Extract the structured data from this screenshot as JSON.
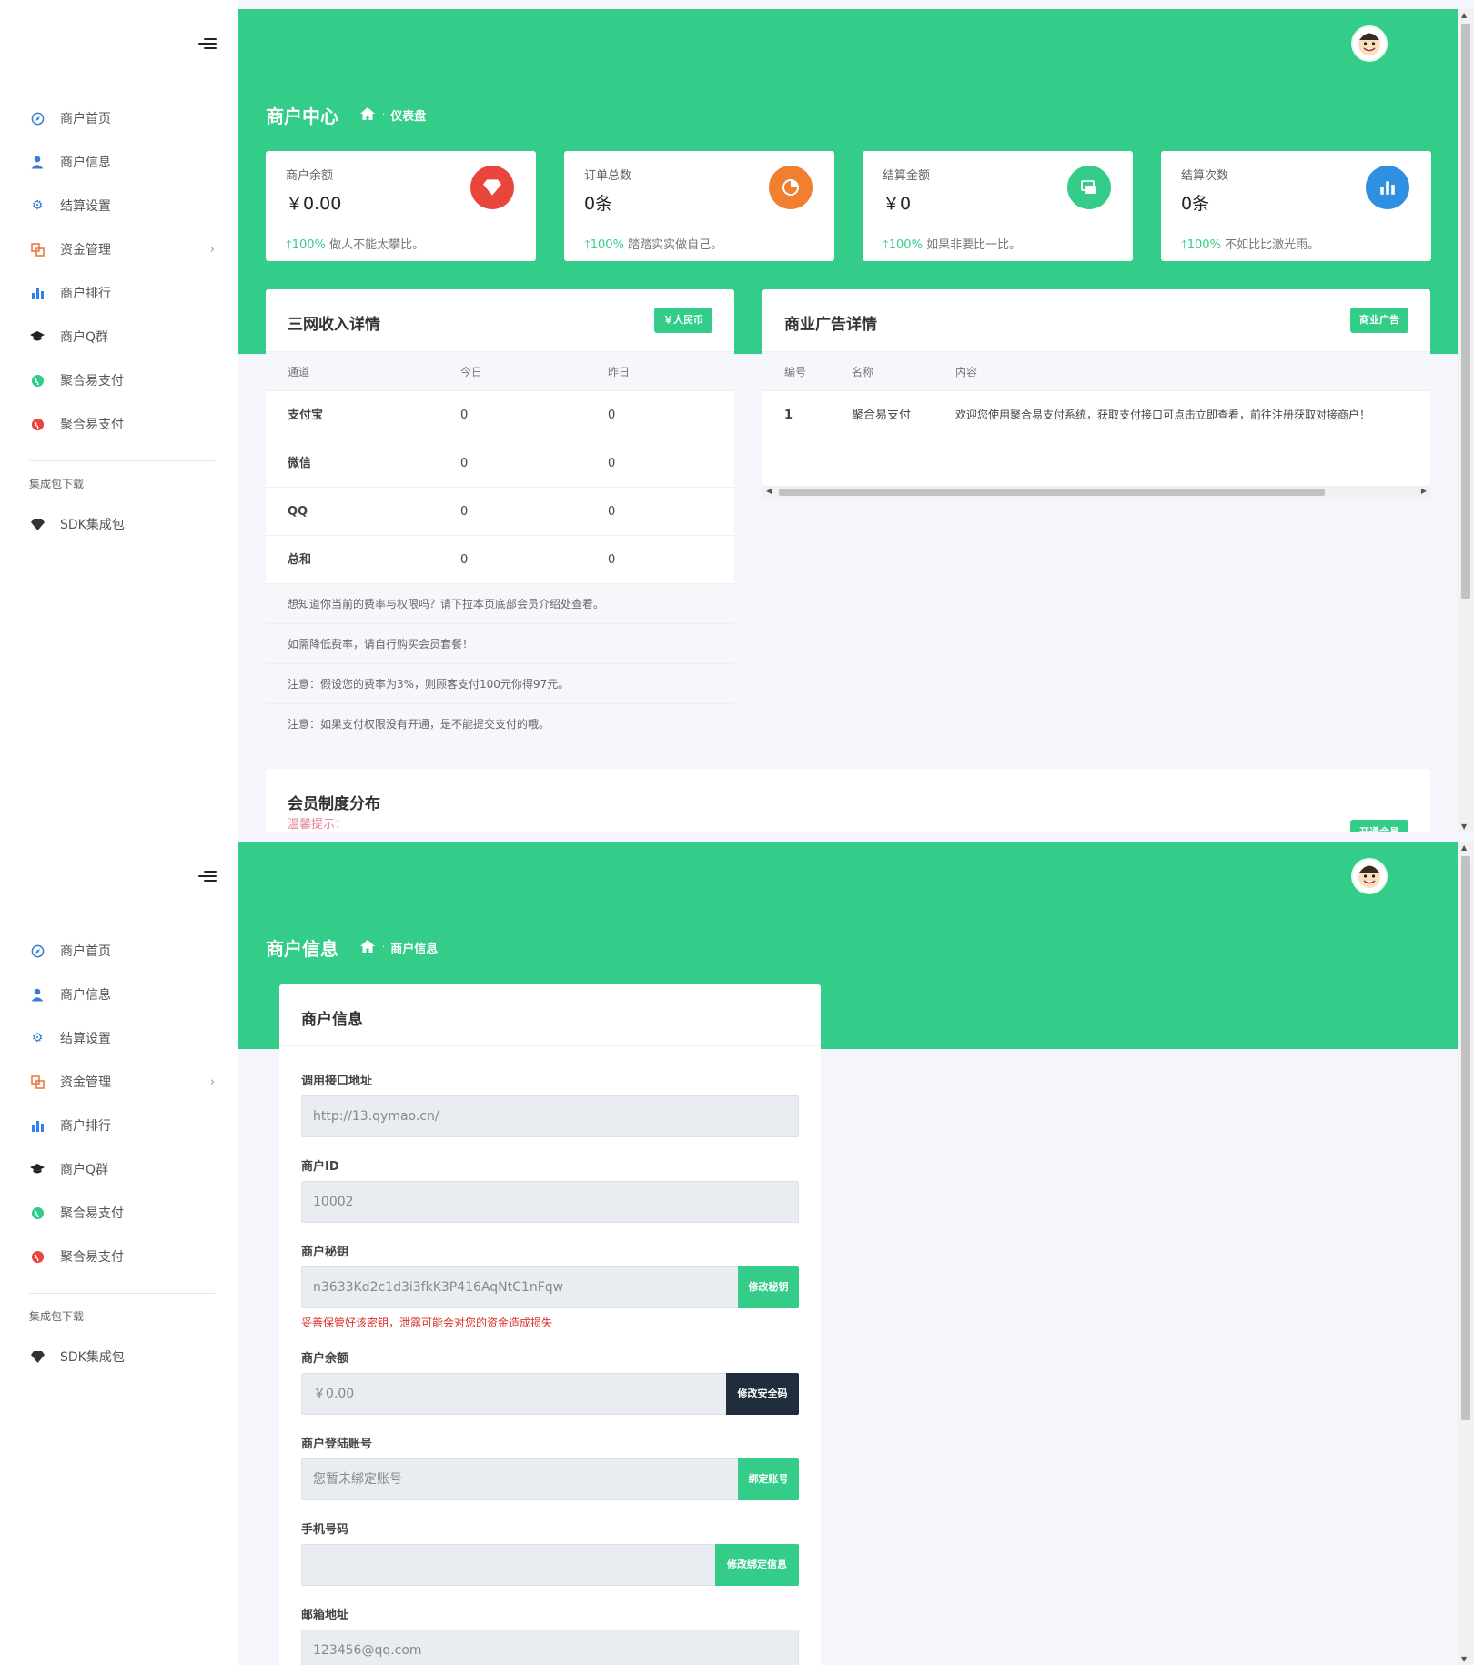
{
  "colors": {
    "brand_green": "#33cc89",
    "dark_navy": "#1f2d3d",
    "warn_red": "#d9322a"
  },
  "sidebar": {
    "items": [
      {
        "label": "商户首页",
        "icon": "compass-icon",
        "color": "#3a7bd5"
      },
      {
        "label": "商户信息",
        "icon": "user-icon",
        "color": "#3a7bd5"
      },
      {
        "label": "结算设置",
        "icon": "gear-icon",
        "color": "#3a7bd5"
      },
      {
        "label": "资金管理",
        "icon": "copy-icon",
        "color": "#e8713a"
      },
      {
        "label": "商户排行",
        "icon": "bar-chart-icon",
        "color": "#2f80ed"
      },
      {
        "label": "商户Q群",
        "icon": "graduation-cap-icon",
        "color": "#222222"
      },
      {
        "label": "聚合易支付",
        "icon": "globe-icon",
        "color": "#33cc89"
      },
      {
        "label": "聚合易支付",
        "icon": "globe-icon",
        "color": "#e8453c"
      }
    ],
    "group_title": "集成包下载",
    "sdk_item": {
      "label": "SDK集成包",
      "icon": "diamond-icon"
    }
  },
  "dashboard": {
    "title": "商户中心",
    "breadcrumb": "仪表盘",
    "stats": [
      {
        "label": "商户余额",
        "value": "￥0.00",
        "percent": "100%",
        "note": "做人不能太攀比。",
        "badge_color": "#e8453c",
        "icon": "diamond-icon"
      },
      {
        "label": "订单总数",
        "value": "0条",
        "percent": "100%",
        "note": "踏踏实实做自己。",
        "badge_color": "#f07f30",
        "icon": "pie-chart-icon"
      },
      {
        "label": "结算金额",
        "value": "￥0",
        "percent": "100%",
        "note": "如果非要比一比。",
        "badge_color": "#33cc89",
        "icon": "money-icon"
      },
      {
        "label": "结算次数",
        "value": "0条",
        "percent": "100%",
        "note": "不如比比激光雨。",
        "badge_color": "#2f8fe0",
        "icon": "bar-chart-icon"
      }
    ],
    "income": {
      "title": "三网收入详情",
      "pill": "￥人民币",
      "columns": [
        "通道",
        "今日",
        "昨日"
      ],
      "rows": [
        [
          "支付宝",
          "0",
          "0"
        ],
        [
          "微信",
          "0",
          "0"
        ],
        [
          "QQ",
          "0",
          "0"
        ],
        [
          "总和",
          "0",
          "0"
        ]
      ],
      "notes": [
        "想知道你当前的费率与权限吗？请下拉本页底部会员介绍处查看。",
        "如需降低费率，请自行购买会员套餐！",
        "注意：假设您的费率为3%，则顾客支付100元你得97元。",
        "注意：如果支付权限没有开通，是不能提交支付的哦。"
      ]
    },
    "ads": {
      "title": "商业广告详情",
      "pill": "商业广告",
      "columns": [
        "编号",
        "名称",
        "内容"
      ],
      "rows": [
        [
          "1",
          "聚合易支付",
          "欢迎您使用聚合易支付系统，获取支付接口可点击立即查看，前往注册获取对接商户！"
        ]
      ]
    },
    "membership": {
      "title": "会员制度分布",
      "hint": "温馨提示：",
      "pill": "开通会员"
    }
  },
  "merchant": {
    "title": "商户信息",
    "breadcrumb": "商户信息",
    "card_title": "商户信息",
    "fields": {
      "api_url": {
        "label": "调用接口地址",
        "value": "http://13.qymao.cn/"
      },
      "merchant_id": {
        "label": "商户ID",
        "value": "10002"
      },
      "secret": {
        "label": "商户秘钥",
        "value": "n3633Kd2c1d3i3fkK3P416AqNtC1nFqw",
        "button": "修改秘钥",
        "warning": "妥善保管好该密钥，泄露可能会对您的资金造成损失"
      },
      "balance": {
        "label": "商户余额",
        "value": "￥0.00",
        "button": "修改安全码"
      },
      "login_account": {
        "label": "商户登陆账号",
        "value": "您暂未绑定账号",
        "button": "绑定账号"
      },
      "phone": {
        "label": "手机号码",
        "value": "",
        "button": "修改绑定信息"
      },
      "email": {
        "label": "邮箱地址",
        "value": "123456@qq.com"
      }
    }
  }
}
